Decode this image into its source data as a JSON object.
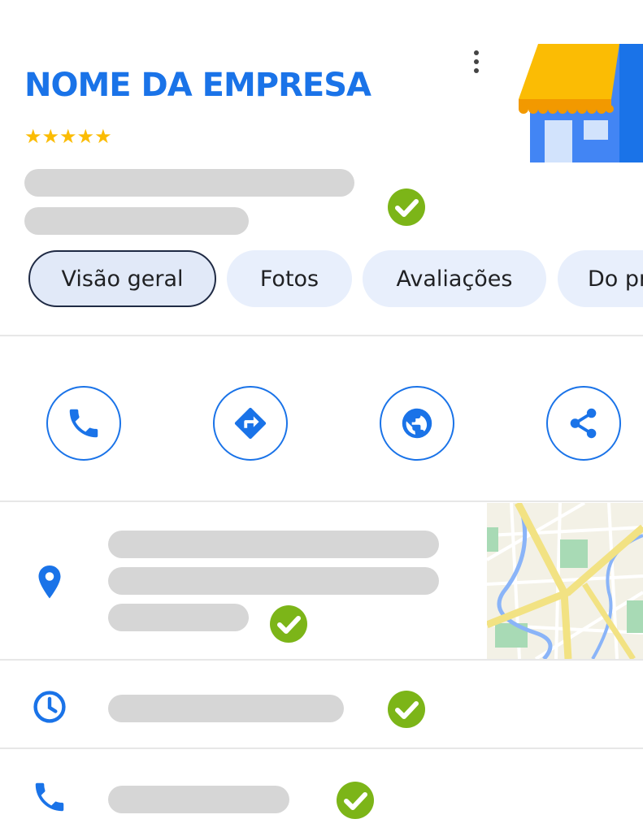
{
  "business": {
    "name": "NOME DA EMPRESA",
    "rating_stars": "★★★★★"
  },
  "tabs": [
    {
      "label": "Visão geral",
      "active": true
    },
    {
      "label": "Fotos",
      "active": false
    },
    {
      "label": "Avaliações",
      "active": false
    },
    {
      "label": "Do proprietário",
      "active": false
    }
  ],
  "actions": [
    {
      "name": "call",
      "icon": "phone-icon"
    },
    {
      "name": "directions",
      "icon": "directions-icon"
    },
    {
      "name": "website",
      "icon": "globe-icon"
    },
    {
      "name": "share",
      "icon": "share-icon"
    }
  ],
  "info_rows": [
    {
      "icon": "location-pin-icon",
      "verified": true
    },
    {
      "icon": "clock-icon",
      "verified": true
    },
    {
      "icon": "phone-icon",
      "verified": true
    }
  ],
  "colors": {
    "brand_blue": "#1a73e8",
    "star_yellow": "#fbbc04",
    "verified_green": "#7cb518",
    "skeleton_gray": "#d6d6d6",
    "tab_background": "#e8effc"
  }
}
